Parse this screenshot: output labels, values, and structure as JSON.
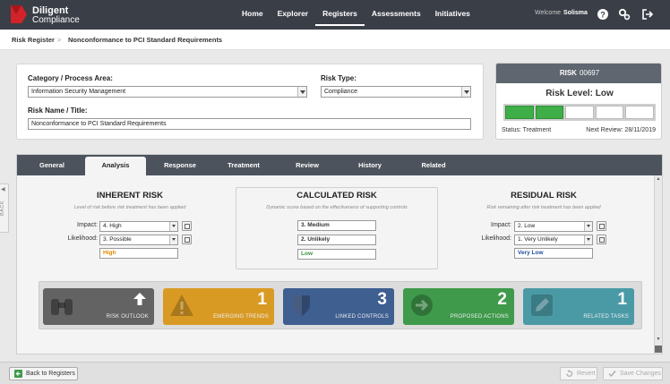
{
  "brand": {
    "name": "Diligent",
    "product": "Compliance",
    "color": "#d2232a"
  },
  "nav": {
    "items": [
      "Home",
      "Explorer",
      "Registers",
      "Assessments",
      "Initiatives"
    ],
    "active": "Registers"
  },
  "user": {
    "welcome": "Welcome",
    "name": "Solisma"
  },
  "top_icons": [
    "help-icon",
    "settings-icon",
    "logout-icon"
  ],
  "breadcrumb": {
    "root": "Risk Register",
    "separator": ">",
    "current": "Nonconformance to PCI Standard Requirements"
  },
  "side": {
    "back_label": "BACK",
    "arrow": "◀"
  },
  "form": {
    "category_label": "Category / Process Area:",
    "category_value": "Information Security Management",
    "risk_type_label": "Risk Type:",
    "risk_type_value": "Compliance",
    "name_label": "Risk Name / Title:",
    "name_value": "Nonconformance to PCI Standard Requirements"
  },
  "risk_card": {
    "label": "RISK",
    "id": "00697",
    "level_text": "Risk Level: Low",
    "meter_total": 5,
    "meter_filled": 2,
    "meter_color": "#3fae49",
    "status": "Status:  Treatment",
    "next_review": "Next Review: 28/11/2019"
  },
  "tabs": [
    "General",
    "Analysis",
    "Response",
    "Treatment",
    "Review",
    "History",
    "Related"
  ],
  "active_tab": "Analysis",
  "inherent": {
    "title": "INHERENT RISK",
    "subtitle": "Level of risk before risk treatment has been applied",
    "impact_label": "Impact:",
    "impact_value": "4. High",
    "likelihood_label": "Likelihood:",
    "likelihood_value": "3. Possible",
    "result": "High",
    "result_color": "#e08a00"
  },
  "calculated": {
    "title": "CALCULATED RISK",
    "subtitle": "Dynamic score based on the effectiveness of supporting controls",
    "impact_value": "3. Medium",
    "likelihood_value": "2. Unlikely",
    "result": "Low",
    "result_color": "#3a8f3f"
  },
  "residual": {
    "title": "RESIDUAL RISK",
    "subtitle": "Risk remaining after risk treatment has been applied",
    "impact_label": "Impact:",
    "impact_value": "2. Low",
    "likelihood_label": "Likelihood:",
    "likelihood_value": "1. Very Unlikely",
    "result": "Very Low",
    "result_color": "#1f4fa0"
  },
  "tiles": [
    {
      "label": "RISK OUTLOOK",
      "count": "",
      "color": "#636363",
      "icon": "binoculars-icon"
    },
    {
      "label": "EMERGING TRENDS",
      "count": "1",
      "color": "#d99a24",
      "icon": "warning-icon"
    },
    {
      "label": "LINKED CONTROLS",
      "count": "3",
      "color": "#3f5f91",
      "icon": "shield-icon"
    },
    {
      "label": "PROPOSED ACTIONS",
      "count": "2",
      "color": "#3f9a4b",
      "icon": "arrow-circle-icon"
    },
    {
      "label": "RELATED TASKS",
      "count": "1",
      "color": "#4a9aa6",
      "icon": "pencil-icon"
    }
  ],
  "footer": {
    "back": "Back to Registers",
    "revert": "Revert",
    "save": "Save Changes"
  }
}
